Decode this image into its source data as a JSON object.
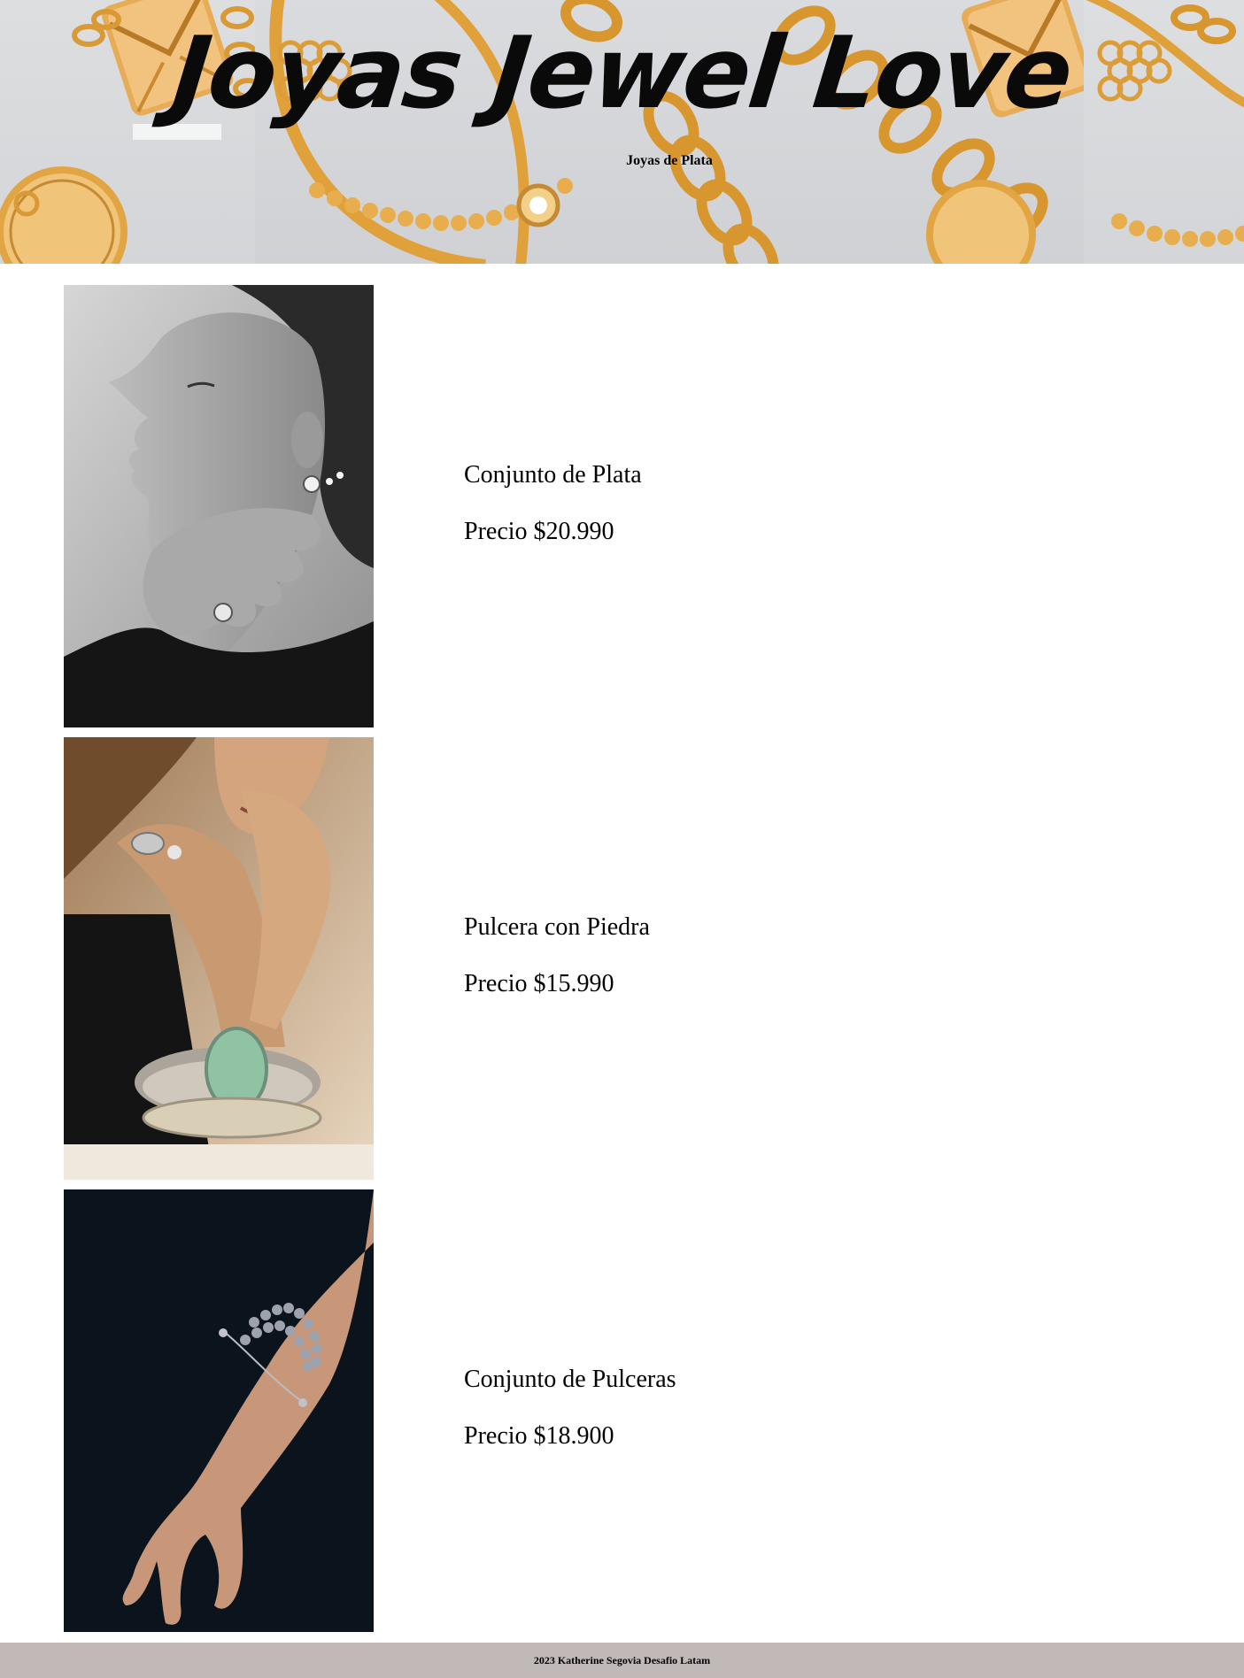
{
  "header": {
    "title": "Joyas Jewel Love",
    "subtitle": "Joyas de Plata"
  },
  "products": [
    {
      "name": "Conjunto de Plata",
      "price": "Precio $20.990",
      "image": "woman-profile-silver-earrings-photo"
    },
    {
      "name": "Pulcera con Piedra",
      "price": "Precio $15.990",
      "image": "woman-hands-stone-bracelet-photo"
    },
    {
      "name": "Conjunto de Pulceras",
      "price": "Precio $18.900",
      "image": "hand-pearl-bracelets-photo"
    }
  ],
  "footer": {
    "text": "2023 Katherine Segovia Desafio Latam"
  },
  "colors": {
    "banner_bg": "#d8dadc",
    "gold": "#e1a640",
    "footer_bg": "#c1b8b8"
  }
}
